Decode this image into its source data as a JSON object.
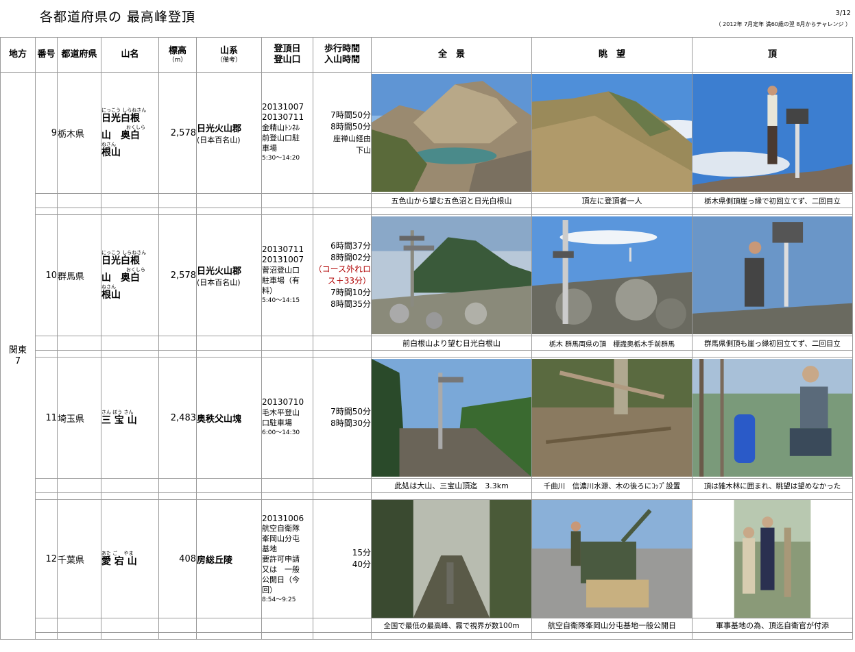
{
  "title": "各都道府県の 最高峰登頂",
  "page": "3/12",
  "subnote": "（ 2012年 7月定年 満60歳の翌 8月からチャレンジ ）",
  "headers": {
    "region": "地方",
    "num": "番号",
    "pref": "都道府県",
    "mtn": "山名",
    "elev": "標高",
    "elev_unit": "（m）",
    "range": "山系",
    "range_note": "（備考）",
    "date1": "登頂日",
    "date2": "登山口",
    "walk1": "歩行時間",
    "walk2": "入山時間",
    "photo1": "全　景",
    "photo2": "眺　望",
    "photo3": "頂"
  },
  "region": {
    "name": "関東",
    "count": "7"
  },
  "rows": [
    {
      "num": "9",
      "pref": "栃木県",
      "mtn_ruby1": "にっこう しらねさん",
      "mtn_line1": "日光白根",
      "mtn_ruby2": "おくしら",
      "mtn_line2": "山　奥白",
      "mtn_ruby3": "ねさん",
      "mtn_line3": "根山",
      "elev": "2,578",
      "range": "日光火山郡",
      "range_note": "(日本百名山)",
      "dates": [
        "20131007",
        "20130711",
        "金精山ﾄﾝﾈﾙ",
        "前登山口駐",
        "車場"
      ],
      "time": "5:30～14:20",
      "walk": [
        "7時間50分",
        "8時間50分",
        "座禅山経由",
        "下山"
      ],
      "captions": [
        "五色山から望む五色沼と日光白根山",
        "頂左に登頂者一人",
        "栃木県側頂崖っ縁で初回立てず、二回目立"
      ]
    },
    {
      "num": "10",
      "pref": "群馬県",
      "mtn_ruby1": "にっこう しらねさん",
      "mtn_line1": "日光白根",
      "mtn_ruby2": "おくしら",
      "mtn_line2": "山　奥白",
      "mtn_ruby3": "ねさん",
      "mtn_line3": "根山",
      "elev": "2,578",
      "range": "日光火山郡",
      "range_note": "(日本百名山)",
      "dates": [
        "20130711",
        "20131007",
        "菅沼登山口",
        "駐車場（有",
        "料）"
      ],
      "time": "5:40～14:15",
      "walk": [
        "6時間37分",
        "8時間02分"
      ],
      "walk_red": [
        "（コース外れロ",
        "ス＋33分）"
      ],
      "walk2": [
        "7時間10分",
        "8時間35分"
      ],
      "captions": [
        "前白根山より望む日光白根山",
        "栃木 群馬両県の頂　標識奥栃木手前群馬",
        "群馬県側頂も崖っ縁初回立てず、二回目立"
      ]
    },
    {
      "num": "11",
      "pref": "埼玉県",
      "mtn_ruby1": "さん ぼう さん",
      "mtn_line1": "三 宝 山",
      "elev": "2,483",
      "range": "奥秩父山塊",
      "dates": [
        "20130710",
        "毛木平登山",
        "口駐車場"
      ],
      "time": "6:00～14:30",
      "walk": [
        "7時間50分",
        "8時間30分"
      ],
      "captions": [
        "此処は大山、三宝山頂迄　3.3km",
        "千曲川　信濃川水源、木の後ろにｺｯﾌﾟ設置",
        "頂は雑木林に囲まれ、眺望は望めなかった"
      ]
    },
    {
      "num": "12",
      "pref": "千葉県",
      "mtn_ruby1": "あた ご　 やま",
      "mtn_line1": "愛 宕 山",
      "elev": "408",
      "range": "房総丘陵",
      "dates": [
        "20131006",
        "航空自衛隊",
        "峯岡山分屯",
        "基地",
        "要許可申請",
        "又は　一般",
        "公開日（今",
        "回）"
      ],
      "time": "8:54～9:25",
      "walk": [
        "15分",
        "40分"
      ],
      "captions": [
        "全国で最低の最高峰、霧で視界が数100m",
        "航空自衛隊峯岡山分屯基地一般公開日",
        "軍事基地の為、頂迄自衛官が付添"
      ]
    }
  ]
}
